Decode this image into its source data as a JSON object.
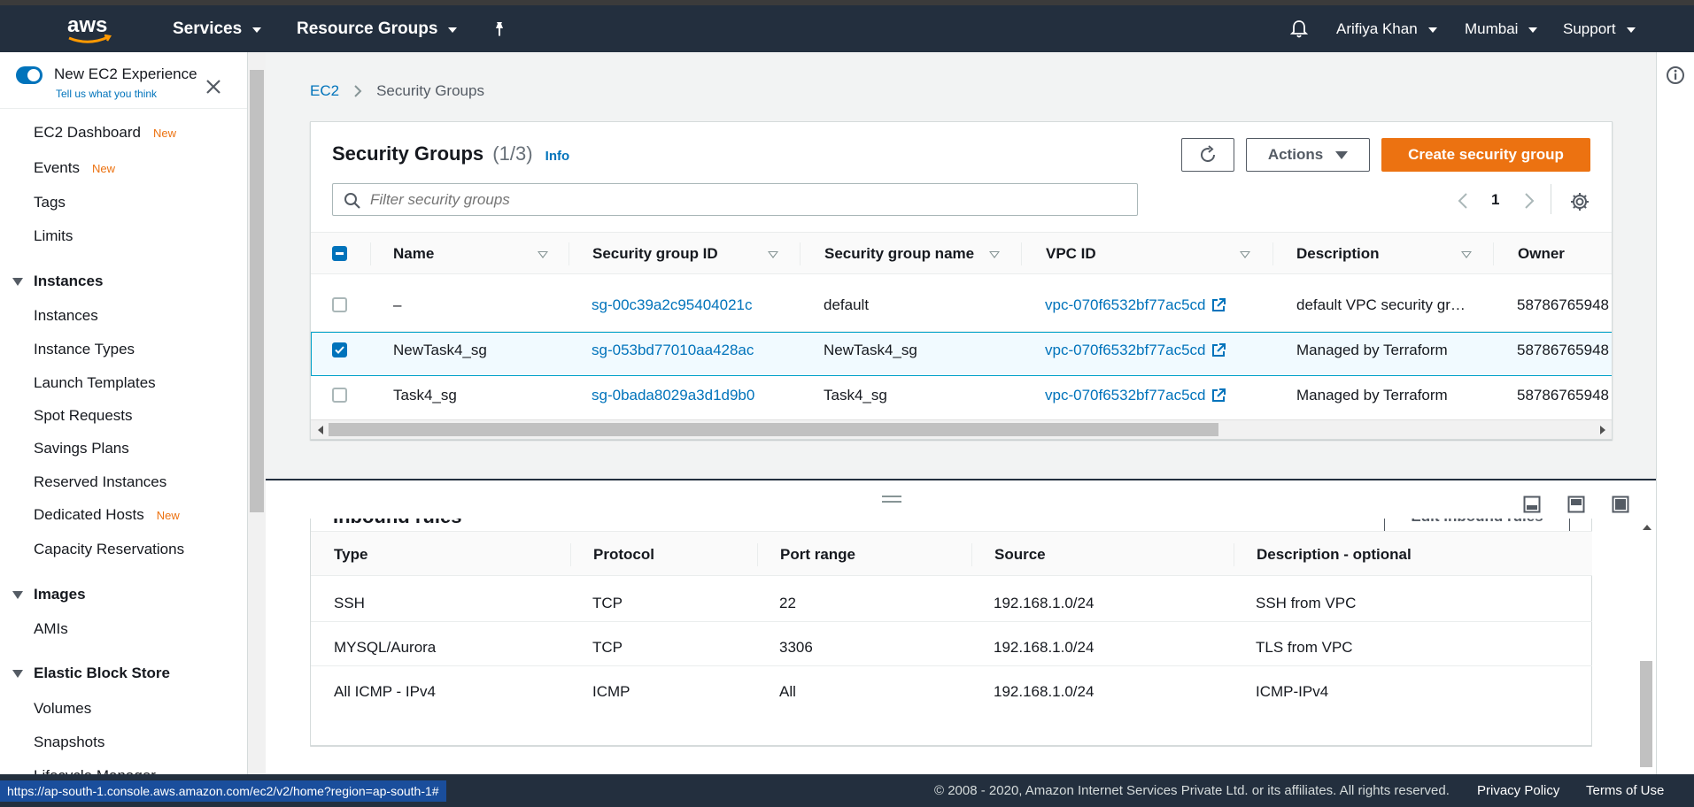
{
  "nav": {
    "services": "Services",
    "resource_groups": "Resource Groups",
    "user": "Arifiya Khan",
    "region": "Mumbai",
    "support": "Support"
  },
  "sidebar": {
    "toggle_title": "New EC2 Experience",
    "toggle_sub": "Tell us what you think",
    "new_badge": "New",
    "items": [
      {
        "label": "EC2 Dashboard",
        "new": true
      },
      {
        "label": "Events",
        "new": true
      },
      {
        "label": "Tags"
      },
      {
        "label": "Limits"
      }
    ],
    "sections": [
      {
        "title": "Instances",
        "items": [
          "Instances",
          "Instance Types",
          "Launch Templates",
          "Spot Requests",
          "Savings Plans",
          "Reserved Instances",
          "Dedicated Hosts",
          "Capacity Reservations"
        ]
      },
      {
        "title": "Images",
        "items": [
          "AMIs"
        ]
      },
      {
        "title": "Elastic Block Store",
        "items": [
          "Volumes",
          "Snapshots",
          "Lifecycle Manager"
        ]
      }
    ]
  },
  "breadcrumb": {
    "root": "EC2",
    "current": "Security Groups"
  },
  "sg_panel": {
    "title": "Security Groups",
    "count": "(1/3)",
    "info": "Info",
    "actions": "Actions",
    "create": "Create security group",
    "filter_placeholder": "Filter security groups",
    "page": "1",
    "columns": [
      "Name",
      "Security group ID",
      "Security group name",
      "VPC ID",
      "Description",
      "Owner"
    ],
    "rows": [
      {
        "name": "–",
        "id": "sg-00c39a2c95404021c",
        "group_name": "default",
        "vpc": "vpc-070f6532bf77ac5cd",
        "desc": "default VPC security gr…",
        "owner": "58786765948",
        "selected": false
      },
      {
        "name": "NewTask4_sg",
        "id": "sg-053bd77010aa428ac",
        "group_name": "NewTask4_sg",
        "vpc": "vpc-070f6532bf77ac5cd",
        "desc": "Managed by Terraform",
        "owner": "58786765948",
        "selected": true
      },
      {
        "name": "Task4_sg",
        "id": "sg-0bada8029a3d1d9b0",
        "group_name": "Task4_sg",
        "vpc": "vpc-070f6532bf77ac5cd",
        "desc": "Managed by Terraform",
        "owner": "58786765948",
        "selected": false
      }
    ]
  },
  "inbound": {
    "title": "Inbound rules",
    "edit": "Edit inbound rules",
    "columns": [
      "Type",
      "Protocol",
      "Port range",
      "Source",
      "Description - optional"
    ],
    "rows": [
      {
        "type": "SSH",
        "protocol": "TCP",
        "port": "22",
        "source": "192.168.1.0/24",
        "desc": "SSH from VPC"
      },
      {
        "type": "MYSQL/Aurora",
        "protocol": "TCP",
        "port": "3306",
        "source": "192.168.1.0/24",
        "desc": "TLS from VPC"
      },
      {
        "type": "All ICMP - IPv4",
        "protocol": "ICMP",
        "port": "All",
        "source": "192.168.1.0/24",
        "desc": "ICMP-IPv4"
      }
    ]
  },
  "footer": {
    "copyright": "© 2008 - 2020, Amazon Internet Services Private Ltd. or its affiliates. All rights reserved.",
    "privacy": "Privacy Policy",
    "terms": "Terms of Use"
  },
  "status_url": "https://ap-south-1.console.aws.amazon.com/ec2/v2/home?region=ap-south-1#",
  "colors": {
    "nav": "#232f3e",
    "accent": "#ec7211",
    "link": "#0073bb"
  }
}
